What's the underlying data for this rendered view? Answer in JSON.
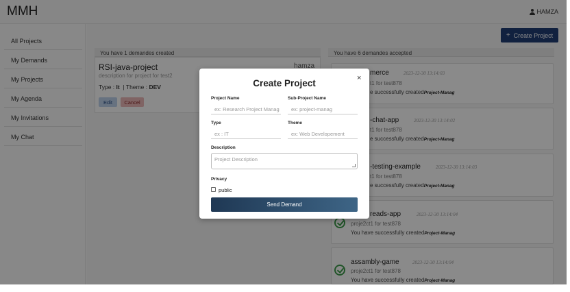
{
  "app": {
    "brand": "MMH",
    "user": "HAMZA"
  },
  "sidebar": {
    "items": [
      {
        "label": "All Projects"
      },
      {
        "label": "My Demands"
      },
      {
        "label": "My Projects"
      },
      {
        "label": "My Agenda"
      },
      {
        "label": "My Invitations"
      },
      {
        "label": "My Chat"
      }
    ]
  },
  "header": {
    "create_button": "Create Project",
    "create_icon": "+"
  },
  "demands": {
    "header": "You have 1 demandes created",
    "card": {
      "title": "RSI-java-project",
      "owner": "hamza",
      "description": "description for project for test2",
      "type_label": "Type :",
      "type_value": "It",
      "theme_label": "| Theme :",
      "theme_value": "DEV",
      "edit": "Edit",
      "cancel": "Cancel"
    }
  },
  "accepted": {
    "header": "You have 6 demandes accepted",
    "items": [
      {
        "name": "e-commerce",
        "visible_name": "merce",
        "date": "2023-12-30 13:14:03",
        "project": "proje2ct1 for test878",
        "visible_project": "t1 for test878",
        "message": "You have successfully created",
        "message_tail": "Project-Manag",
        "visible_message": "e successfully created"
      },
      {
        "name": "chat-app",
        "visible_name": "-chat-app",
        "date": "2023-12-30 13:14:02",
        "project": "proje2ct1 for test878",
        "visible_project": "t1 for test878",
        "message": "You have successfully created",
        "message_tail": "Project-Manag",
        "visible_message": "e successfully created"
      },
      {
        "name": "testing-example",
        "visible_name": "-testing-example",
        "date": "2023-12-30 13:14:03",
        "project": "proje2ct1 for test878",
        "visible_project": "t1 for test878",
        "message": "You have successfully created",
        "message_tail": "Project-Manag",
        "visible_message": "e successfully created"
      },
      {
        "name": "threads-app",
        "visible_name": "reads-app",
        "date": "2023-12-30 13:14:04",
        "project": "proje2ct1 for test878",
        "visible_project": "proje2ct1 for test878",
        "message": "You have successfully created",
        "message_tail": "Project-Manag",
        "visible_message": "You have successfully created"
      },
      {
        "name": "assambly-game",
        "visible_name": "assambly-game",
        "date": "2023-12-30 13:14:04",
        "project": "proje2ct1 for test878",
        "visible_project": "proje2ct1 for test878",
        "message": "You have successfully created",
        "message_tail": "Project-Manag",
        "visible_message": "You have successfully created"
      }
    ]
  },
  "modal": {
    "title": "Create Project",
    "close": "×",
    "project_name_label": "Project Name",
    "project_name_placeholder": "ex: Research Project Manag",
    "sub_project_label": "Sub-Project Name",
    "sub_project_placeholder": "ex: project-manag",
    "type_label": "Type",
    "type_placeholder": "ex : IT",
    "theme_label": "Theme",
    "theme_placeholder": "ex: Web Developement",
    "description_label": "Description",
    "description_placeholder": "Project Description",
    "privacy_label": "Privacy",
    "public_label": "public",
    "send_button": "Send Demand"
  }
}
